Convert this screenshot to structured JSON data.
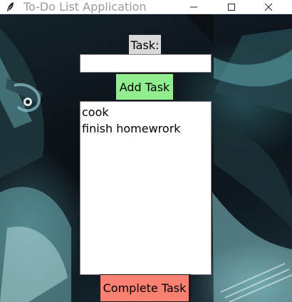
{
  "window": {
    "title": "To-Do List Application",
    "controls": [
      "minimize",
      "maximize",
      "close"
    ]
  },
  "form": {
    "task_label": "Task:",
    "task_input_value": "",
    "add_button_label": "Add Task"
  },
  "task_list": {
    "items": [
      "cook",
      "finish homewrork"
    ]
  },
  "complete_button_label": "Complete Task",
  "colors": {
    "add_button_bg": "#90ee90",
    "complete_button_bg": "#fa8072",
    "label_bg": "#d9d9d9"
  },
  "icons": {
    "app": "feather-icon",
    "minimize": "minimize-icon",
    "maximize": "maximize-icon",
    "close": "close-icon"
  }
}
